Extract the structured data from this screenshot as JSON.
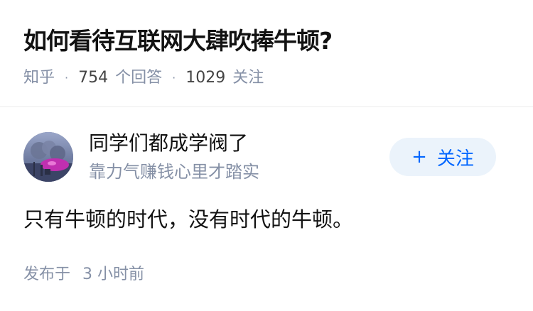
{
  "question": {
    "title": "如何看待互联网大肆吹捧牛顿?",
    "source": "知乎",
    "separator": "·",
    "answer_count": "754",
    "answer_label": "个回答",
    "follow_count": "1029",
    "follow_label": "关注"
  },
  "answer": {
    "author_name": "同学们都成学阀了",
    "author_bio": "靠力气赚钱心里才踏实",
    "follow_button": {
      "icon": "+",
      "label": "关注"
    },
    "content": "只有牛顿的时代，没有时代的牛顿。",
    "posted_label": "发布于",
    "posted_time": "3 小时前"
  },
  "colors": {
    "primary": "#0066ff",
    "muted": "#8590a6",
    "follow_bg": "#ebf3fb",
    "text": "#121212"
  }
}
